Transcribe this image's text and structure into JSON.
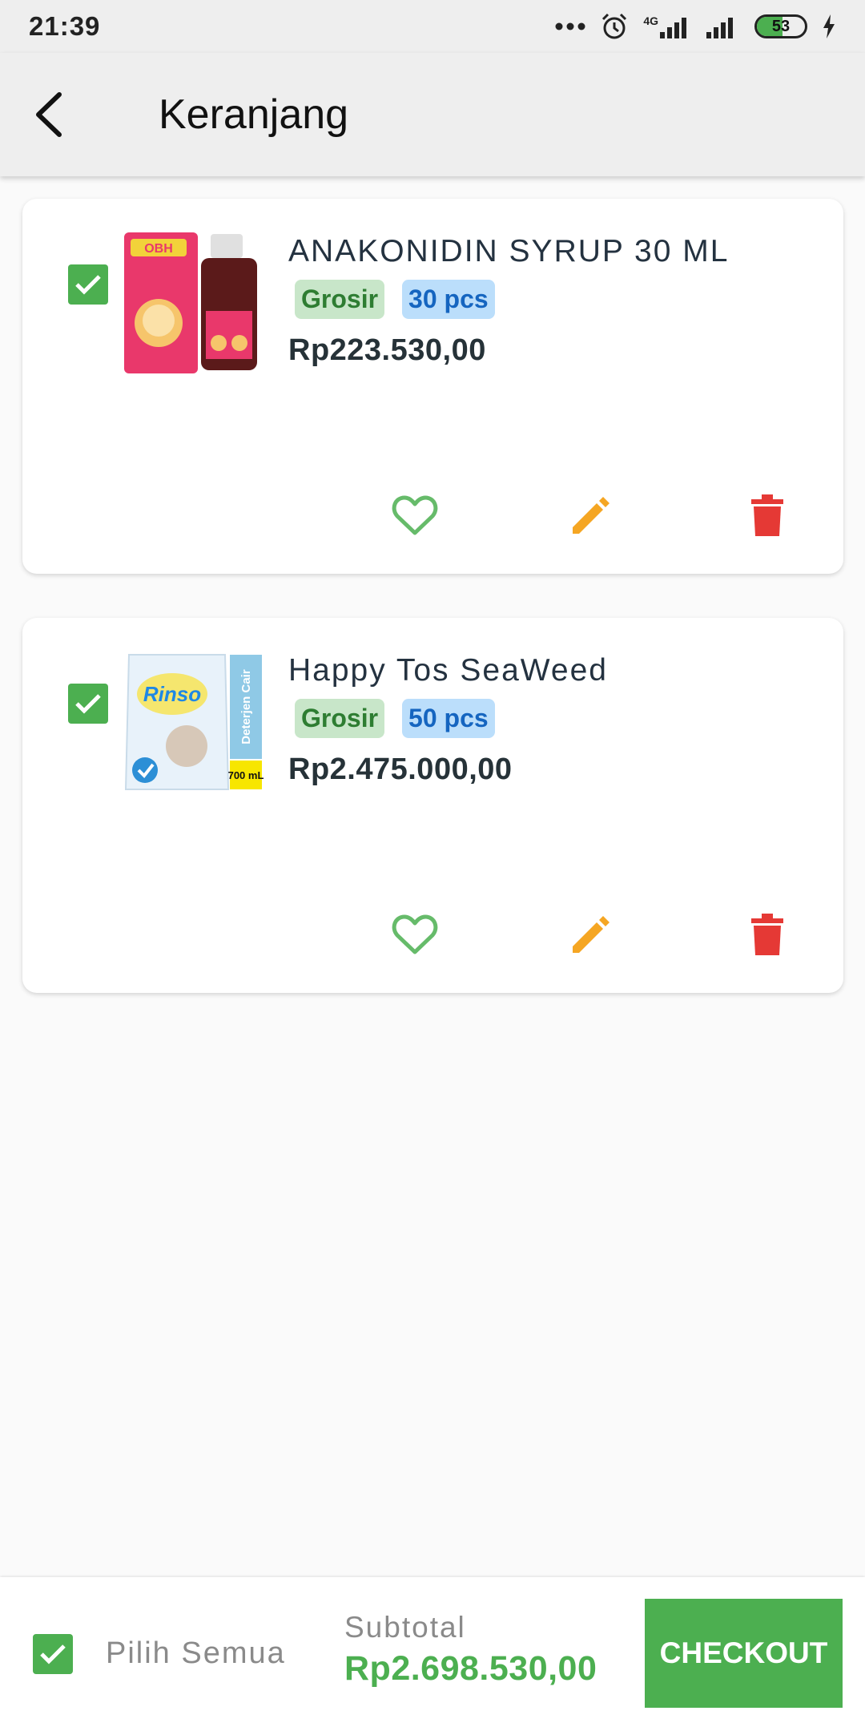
{
  "status_bar": {
    "time": "21:39",
    "network_label": "4G",
    "battery": "53",
    "battery_level": 0.53,
    "icons": [
      "more-dots-icon",
      "alarm-icon",
      "signal-icon",
      "signal-icon",
      "battery-icon",
      "charging-icon"
    ]
  },
  "app_bar": {
    "title": "Keranjang",
    "back_icon": "arrow-back-icon"
  },
  "cart_items": [
    {
      "name": "ANAKONIDIN SYRUP 30 ML",
      "image_label": "OBH",
      "tag_type": "Grosir",
      "quantity": "30 pcs",
      "price": "Rp223.530,00",
      "checked": true
    },
    {
      "name": "Happy Tos SeaWeed",
      "image_label": "Rinso",
      "image_side_label": "Deterjen Cair",
      "image_volume": "700 mL",
      "tag_type": "Grosir",
      "quantity": "50 pcs",
      "price": "Rp2.475.000,00",
      "checked": true
    }
  ],
  "actions": {
    "favorite_icon": "heart-outline-icon",
    "edit_icon": "pencil-icon",
    "delete_icon": "trash-icon"
  },
  "bottom_bar": {
    "select_all_label": "Pilih Semua",
    "subtotal_label": "Subtotal",
    "subtotal_value": "Rp2.698.530,00",
    "checkout_label": "CHECKOUT"
  },
  "colors": {
    "accent": "#4caf50",
    "edit": "#f5a623",
    "delete": "#e53935",
    "favorite": "#66bb6a",
    "tag_grosir_bg": "#c8e6c9",
    "tag_qty_bg": "#bbdefb"
  }
}
